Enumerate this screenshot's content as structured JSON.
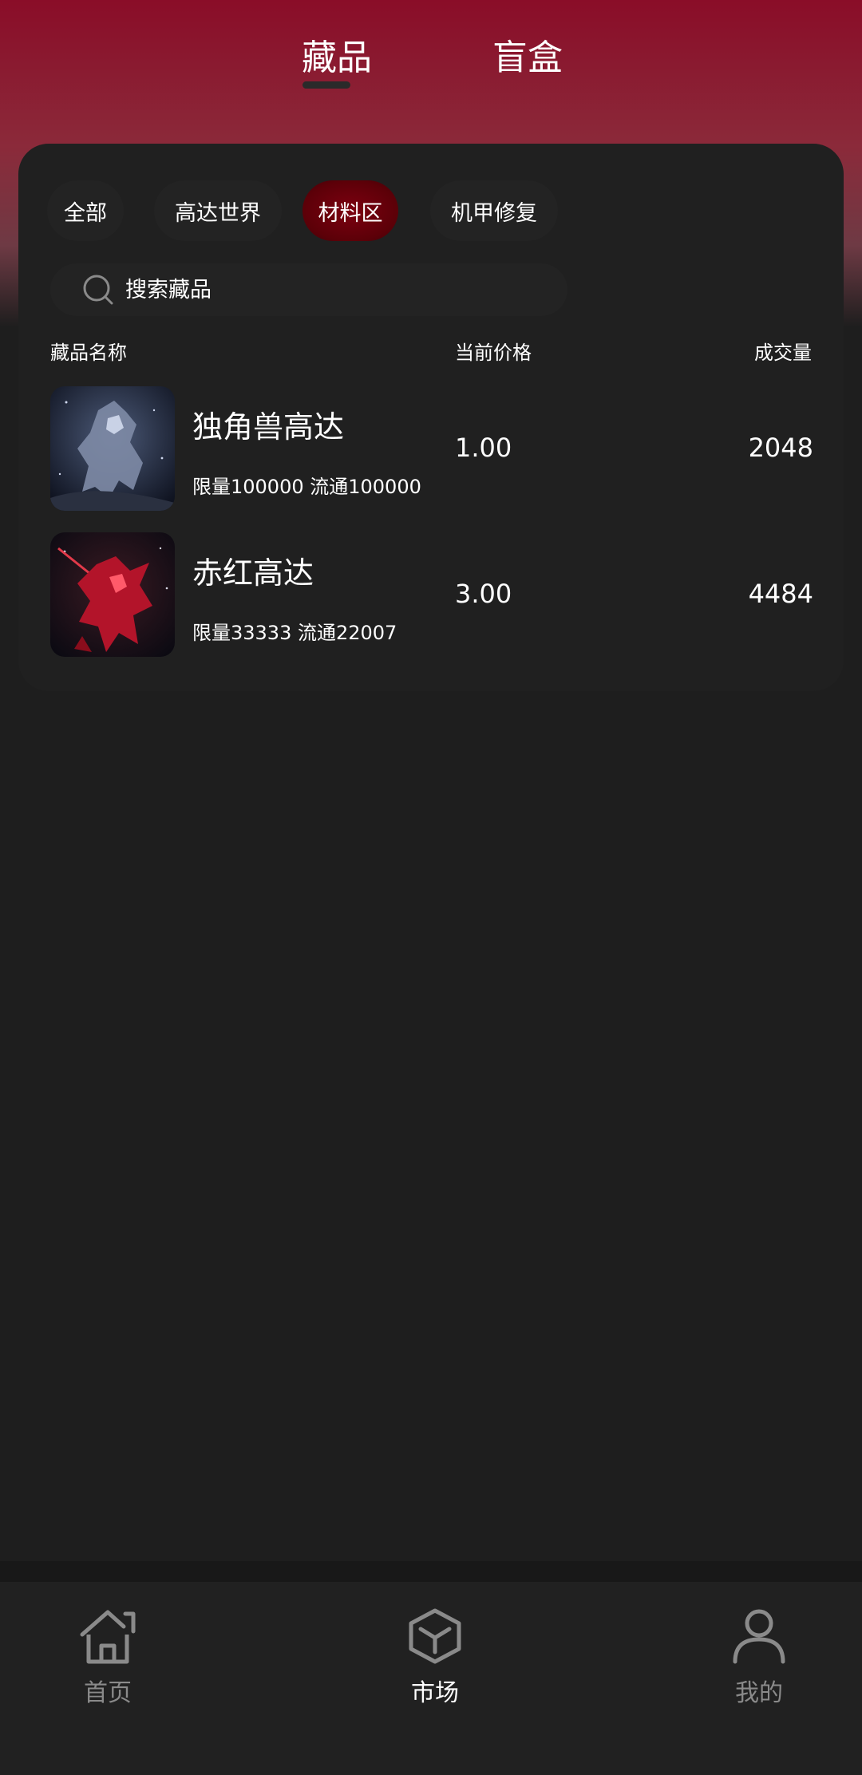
{
  "top_tabs": {
    "collections": "藏品",
    "blind_box": "盲盒",
    "active": "collections"
  },
  "categories": [
    {
      "label": "全部"
    },
    {
      "label": "高达世界"
    },
    {
      "label": "材料区"
    },
    {
      "label": "机甲修复"
    }
  ],
  "active_category": "材料区",
  "search": {
    "placeholder": "搜索藏品",
    "value": ""
  },
  "table": {
    "headers": {
      "name": "藏品名称",
      "price": "当前价格",
      "volume": "成交量"
    },
    "rows": [
      {
        "name": "独角兽高达",
        "meta": "限量100000 流通100000",
        "price": "1.00",
        "volume": "2048",
        "thumb_color": "#3b4a66"
      },
      {
        "name": "赤红高达",
        "meta": "限量33333 流通22007",
        "price": "3.00",
        "volume": "4484",
        "thumb_color": "#b3142a"
      }
    ]
  },
  "bottom_nav": {
    "items": [
      {
        "label": "首页",
        "icon": "home-icon",
        "active": false
      },
      {
        "label": "市场",
        "icon": "cube-icon",
        "active": true
      },
      {
        "label": "我的",
        "icon": "user-icon",
        "active": false
      }
    ]
  },
  "colors": {
    "background": "#1e1e1e",
    "card": "#202020",
    "accent": "#7d0010",
    "header_gradient_top": "#8a0d28",
    "inactive_icon": "#8a8a8a"
  }
}
